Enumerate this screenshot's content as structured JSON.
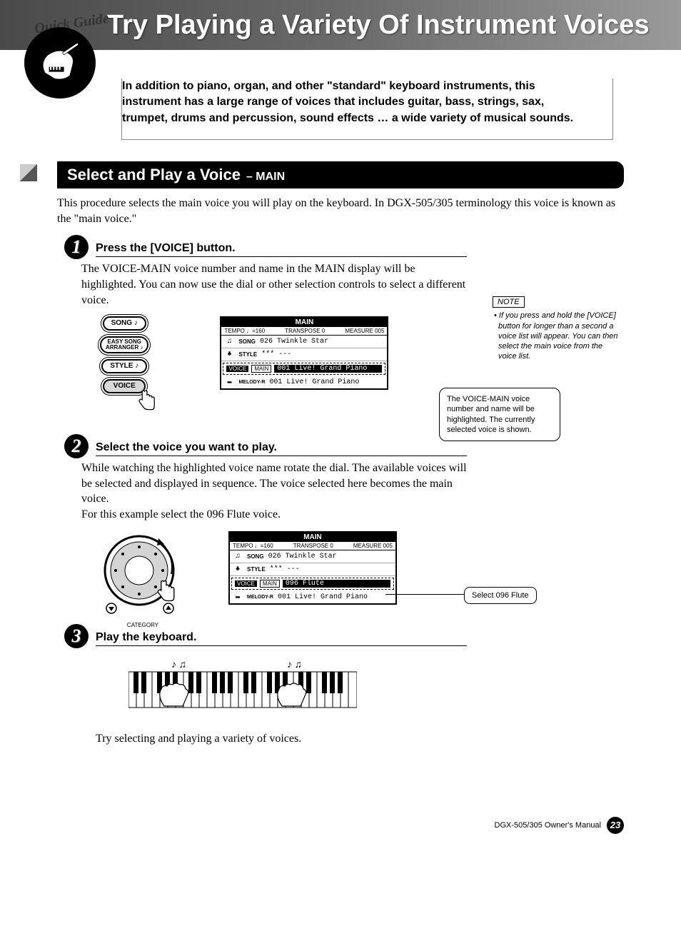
{
  "badge_text": "Quick Guide",
  "title": "Try Playing a Variety Of Instrument Voices",
  "intro": "In addition to piano, organ, and other \"standard\" keyboard instruments, this instrument has a large range of voices that includes guitar, bass, strings, sax, trumpet, drums and percussion, sound effects … a wide variety of musical sounds.",
  "section": {
    "heading": "Select and Play a Voice",
    "subheading": "– MAIN",
    "intro": "This procedure selects the main voice you will play on the keyboard. In DGX-505/305 terminology this voice is known as the \"main voice.\""
  },
  "steps": [
    {
      "num": "1",
      "title": "Press the [VOICE] button.",
      "body": "The VOICE-MAIN voice number and name in the MAIN display will be highlighted. You can now use the dial or other selection controls to select a different voice."
    },
    {
      "num": "2",
      "title": "Select the voice you want to play.",
      "body": "While watching the highlighted voice name rotate the dial. The available voices will be selected and displayed in sequence. The voice selected here becomes the main voice.",
      "body2": "For this example select the 096 Flute voice."
    },
    {
      "num": "3",
      "title": "Play the keyboard.",
      "body": "Try selecting and playing a variety of voices."
    }
  ],
  "controls": {
    "song": "SONG ♪",
    "easy": "EASY SONG\nARRANGER ♪",
    "style": "STYLE ♪",
    "voice": "VOICE"
  },
  "lcd": {
    "header": "MAIN",
    "tempo": "TEMPO ♩=160",
    "transpose": "TRANSPOSE 0",
    "measure": "MEASURE 005",
    "song_label": "SONG",
    "song_val": "026 Twinkle Star",
    "style_label": "STYLE",
    "style_val": "*** ---",
    "voice_side": "VOICE",
    "voice_tab": "MAIN",
    "voice1_val": "001 Live! Grand Piano",
    "voice2_val": "096 Flute",
    "melody_label": "MELODY-R",
    "melody_val": "001 Live! Grand Piano"
  },
  "callouts": {
    "c1": "The VOICE-MAIN voice number and name will be highlighted. The currently selected voice is shown.",
    "c2": "Select 096 Flute"
  },
  "note": {
    "label": "NOTE",
    "body": "• If you press and hold the [VOICE] button for longer than a second a voice list will appear. You can then select the main voice from the voice list."
  },
  "dial_label": "CATEGORY",
  "footer": {
    "manual": "DGX-505/305  Owner's Manual",
    "page": "23"
  }
}
